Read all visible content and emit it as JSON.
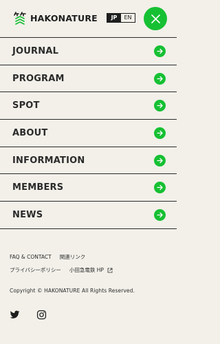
{
  "header": {
    "logo_text": "HAKONATURE",
    "lang": {
      "jp": "JP",
      "en": "EN",
      "active": "JP"
    }
  },
  "menu": {
    "items": [
      {
        "label": "JOURNAL"
      },
      {
        "label": "PROGRAM"
      },
      {
        "label": "SPOT"
      },
      {
        "label": "ABOUT"
      },
      {
        "label": "INFORMATION"
      },
      {
        "label": "MEMBERS"
      },
      {
        "label": "NEWS"
      }
    ]
  },
  "footer": {
    "links_row1": [
      "FAQ & CONTACT",
      "関連リンク"
    ],
    "links_row2": [
      "プライバシーポリシー",
      "小田急電鉄 HP"
    ],
    "copyright": "Copyright © HAKONATURE All Rights Reserved."
  },
  "colors": {
    "accent": "#16c033",
    "background": "#f2f0e9",
    "text": "#2b2b2b"
  },
  "icons": [
    "logo-mark-icon",
    "close-icon",
    "arrow-right-icon",
    "external-link-icon",
    "twitter-icon",
    "instagram-icon"
  ]
}
